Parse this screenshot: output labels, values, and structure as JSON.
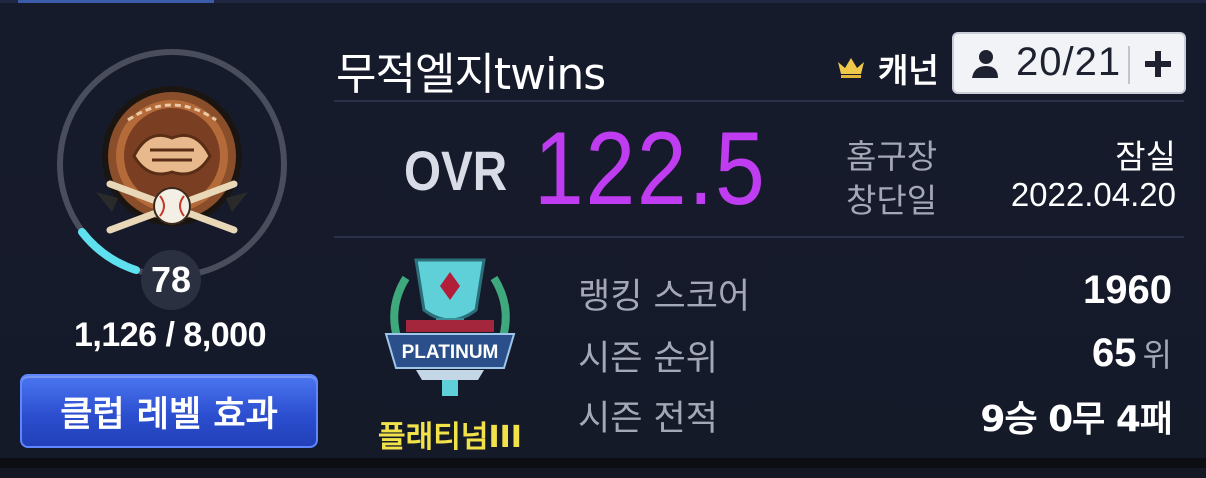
{
  "club": {
    "name": "무적엘지twins",
    "captain_label": "캐넌",
    "members": "20/21"
  },
  "level": {
    "value": "78",
    "exp_text": "1,126 / 8,000",
    "exp_fraction": 0.14,
    "effect_button": "클럽 레벨 효과"
  },
  "overview": {
    "ovr_label": "OVR",
    "ovr_value": "122.5",
    "home_label": "홈구장",
    "home_value": "잠실",
    "founded_label": "창단일",
    "founded_value": "2022.04.20"
  },
  "league": {
    "name": "플래티넘III",
    "stats": [
      {
        "label": "랭킹 스코어",
        "value": "1960",
        "unit": ""
      },
      {
        "label": "시즌 순위",
        "value": "65",
        "unit": "위"
      },
      {
        "label": "시즌 전적",
        "value": "9승 0무 4패",
        "unit": ""
      }
    ]
  },
  "icons": [
    "crown-icon",
    "person-icon",
    "plus-icon",
    "club-emblem",
    "platinum-league-emblem"
  ],
  "colors": {
    "ovr": "#bf3cf0",
    "league_name": "#f2e24a",
    "button": "#2c4fd0",
    "exp_progress": "#5fe0ee"
  }
}
